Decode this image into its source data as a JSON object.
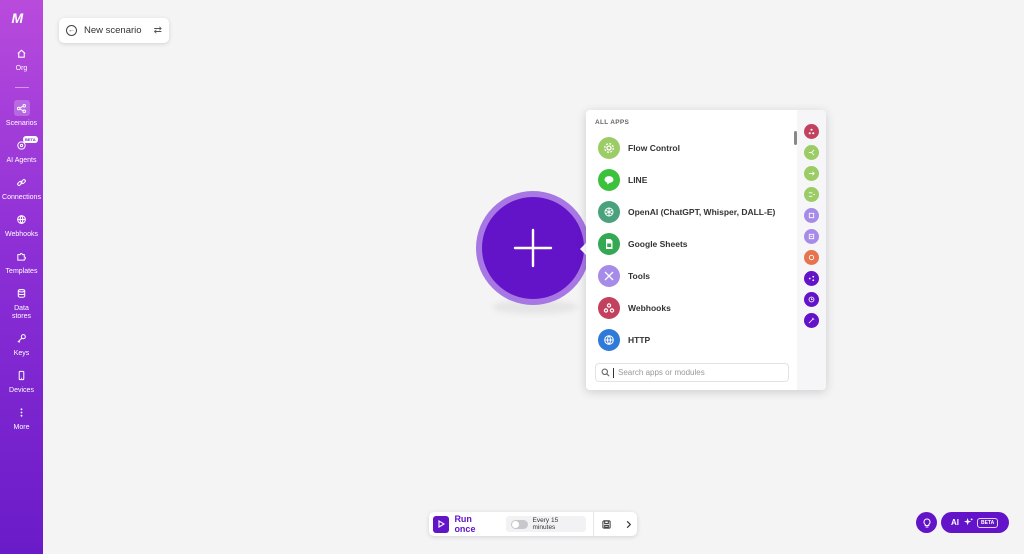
{
  "brand": {
    "logo_text": "M"
  },
  "sidebar": {
    "items": [
      {
        "label": "Org",
        "icon": "home-icon"
      },
      {
        "label": "Scenarios",
        "icon": "share-nodes-icon",
        "active": true
      },
      {
        "label": "AI Agents",
        "icon": "ai-agent-icon",
        "badge": "BETA"
      },
      {
        "label": "Connections",
        "icon": "link-icon"
      },
      {
        "label": "Webhooks",
        "icon": "globe-icon"
      },
      {
        "label": "Templates",
        "icon": "puzzle-icon"
      },
      {
        "label": "Data stores",
        "icon": "database-icon"
      },
      {
        "label": "Keys",
        "icon": "key-icon"
      },
      {
        "label": "Devices",
        "icon": "phone-icon"
      },
      {
        "label": "More",
        "icon": "more-vertical-icon"
      }
    ]
  },
  "scenario": {
    "name": "New scenario"
  },
  "app_picker": {
    "heading": "ALL APPS",
    "apps": [
      {
        "name": "Flow Control",
        "color": "#9ccc65"
      },
      {
        "name": "LINE",
        "color": "#3cc13c"
      },
      {
        "name": "OpenAI (ChatGPT, Whisper, DALL-E)",
        "color": "#4aa27c"
      },
      {
        "name": "Google Sheets",
        "color": "#34a853"
      },
      {
        "name": "Tools",
        "color": "#a68ce8"
      },
      {
        "name": "Webhooks",
        "color": "#c2415e"
      },
      {
        "name": "HTTP",
        "color": "#2f7ad8"
      }
    ],
    "rail_colors": [
      "#c2415e",
      "#9ccc65",
      "#9ccc65",
      "#9ccc65",
      "#a68ce8",
      "#a68ce8",
      "#e7744f",
      "#6414c8",
      "#6414c8",
      "#6414c8"
    ],
    "search_placeholder": "Search apps or modules"
  },
  "toolbar": {
    "run_label": "Run once",
    "schedule_label": "Every 15 minutes",
    "schedule_enabled": false
  },
  "assistant": {
    "label": "AI",
    "badge": "BETA"
  }
}
